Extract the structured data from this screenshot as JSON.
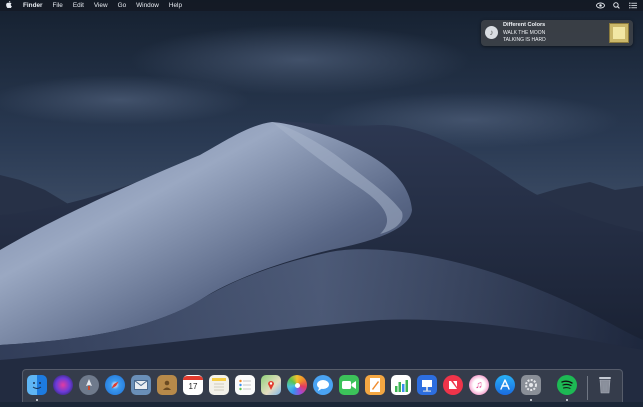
{
  "menubar": {
    "apple_icon": "apple-icon",
    "items": [
      "Finder",
      "File",
      "Edit",
      "View",
      "Go",
      "Window",
      "Help"
    ],
    "right_icons": [
      "eye-icon",
      "spotlight-search-icon",
      "notification-center-icon"
    ]
  },
  "notification": {
    "title": "Different Colors",
    "artist": "WALK THE MOON",
    "album": "TALKING IS HARD",
    "icon": "music-note-icon"
  },
  "dock": {
    "apps": [
      {
        "name": "finder-icon"
      },
      {
        "name": "siri-icon"
      },
      {
        "name": "launchpad-icon"
      },
      {
        "name": "safari-icon"
      },
      {
        "name": "mail-icon"
      },
      {
        "name": "contacts-icon"
      },
      {
        "name": "calendar-icon",
        "text": "17"
      },
      {
        "name": "notes-icon"
      },
      {
        "name": "reminders-icon"
      },
      {
        "name": "maps-icon"
      },
      {
        "name": "photos-icon"
      },
      {
        "name": "messages-icon"
      },
      {
        "name": "facetime-icon"
      },
      {
        "name": "pages-icon"
      },
      {
        "name": "numbers-icon"
      },
      {
        "name": "keynote-icon"
      },
      {
        "name": "news-icon"
      },
      {
        "name": "itunes-icon"
      },
      {
        "name": "app-store-icon"
      },
      {
        "name": "system-preferences-icon"
      },
      {
        "name": "spotify-icon"
      },
      {
        "name": "trash-icon"
      }
    ]
  },
  "colors": {
    "sky": "#1f2e45",
    "dune_light": "#8a99b6",
    "dune_dark": "#1c2436"
  }
}
